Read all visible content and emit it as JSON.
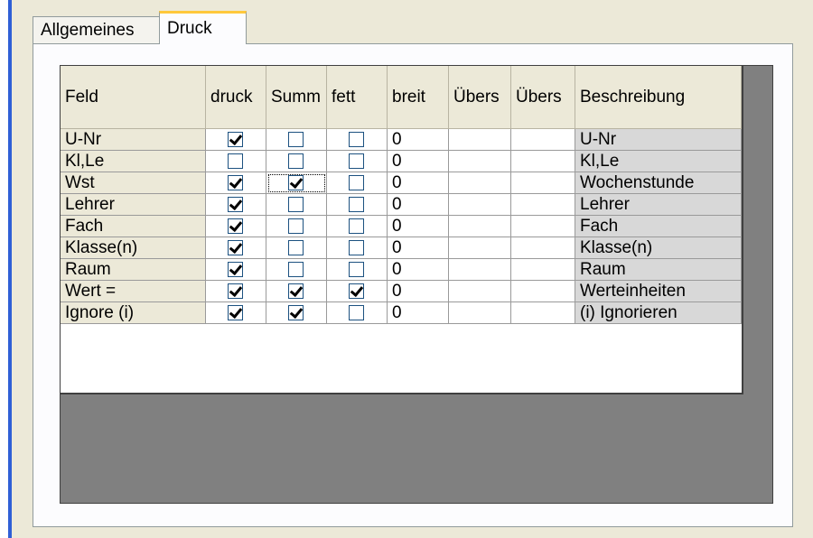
{
  "tabs": [
    {
      "label": "Allgemeines",
      "active": false
    },
    {
      "label": "Druck",
      "active": true
    }
  ],
  "grid": {
    "columns": [
      "Feld",
      "druck",
      "Summ",
      "fett",
      "breit",
      "Übers",
      "Übers",
      "Beschreibung"
    ],
    "rows": [
      {
        "feld": "U-Nr",
        "druck": true,
        "summ": false,
        "fett": false,
        "breit": "0",
        "ubers1": "",
        "ubers2": "",
        "beschreibung": "U-Nr"
      },
      {
        "feld": "Kl,Le",
        "druck": false,
        "summ": false,
        "fett": false,
        "breit": "0",
        "ubers1": "",
        "ubers2": "",
        "beschreibung": "Kl,Le"
      },
      {
        "feld": "Wst",
        "druck": true,
        "summ": true,
        "fett": false,
        "breit": "0",
        "ubers1": "",
        "ubers2": "",
        "beschreibung": "Wochenstunde"
      },
      {
        "feld": "Lehrer",
        "druck": true,
        "summ": false,
        "fett": false,
        "breit": "0",
        "ubers1": "",
        "ubers2": "",
        "beschreibung": "Lehrer"
      },
      {
        "feld": "Fach",
        "druck": true,
        "summ": false,
        "fett": false,
        "breit": "0",
        "ubers1": "",
        "ubers2": "",
        "beschreibung": "Fach"
      },
      {
        "feld": "Klasse(n)",
        "druck": true,
        "summ": false,
        "fett": false,
        "breit": "0",
        "ubers1": "",
        "ubers2": "",
        "beschreibung": "Klasse(n)"
      },
      {
        "feld": "Raum",
        "druck": true,
        "summ": false,
        "fett": false,
        "breit": "0",
        "ubers1": "",
        "ubers2": "",
        "beschreibung": "Raum"
      },
      {
        "feld": "Wert =",
        "druck": true,
        "summ": true,
        "fett": true,
        "breit": "0",
        "ubers1": "",
        "ubers2": "",
        "beschreibung": "Werteinheiten"
      },
      {
        "feld": "Ignore (i)",
        "druck": true,
        "summ": true,
        "fett": false,
        "breit": "0",
        "ubers1": "",
        "ubers2": "",
        "beschreibung": "(i) Ignorieren"
      }
    ]
  },
  "colors": {
    "window_bg": "#ece9d8",
    "grid_bg": "#808080",
    "active_tab_accent": "#ffc83c",
    "left_accent": "#2f5fd6"
  }
}
